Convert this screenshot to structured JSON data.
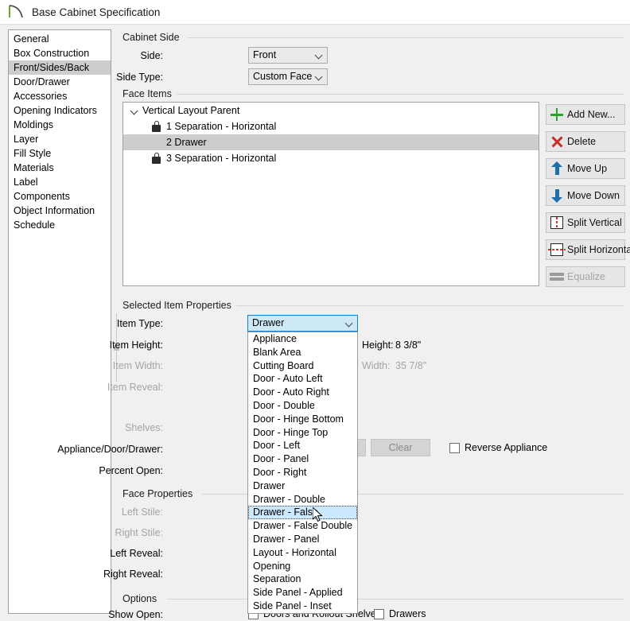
{
  "window": {
    "title": "Base Cabinet Specification",
    "icon": "cabinet-arc-icon"
  },
  "sidebar": {
    "items": [
      {
        "label": "General",
        "selected": false
      },
      {
        "label": "Box Construction",
        "selected": false
      },
      {
        "label": "Front/Sides/Back",
        "selected": true
      },
      {
        "label": "Door/Drawer",
        "selected": false
      },
      {
        "label": "Accessories",
        "selected": false
      },
      {
        "label": "Opening Indicators",
        "selected": false
      },
      {
        "label": "Moldings",
        "selected": false
      },
      {
        "label": "Layer",
        "selected": false
      },
      {
        "label": "Fill Style",
        "selected": false
      },
      {
        "label": "Materials",
        "selected": false
      },
      {
        "label": "Label",
        "selected": false
      },
      {
        "label": "Components",
        "selected": false
      },
      {
        "label": "Object Information",
        "selected": false
      },
      {
        "label": "Schedule",
        "selected": false
      }
    ]
  },
  "cabinet_side": {
    "title": "Cabinet Side",
    "side_label": "Side:",
    "side_value": "Front",
    "side_type_label": "Side Type:",
    "side_type_value": "Custom Face"
  },
  "face_items": {
    "title": "Face Items",
    "tree": [
      {
        "label": "Vertical Layout Parent",
        "indent": 0,
        "caret": true,
        "lock": false,
        "selected": false
      },
      {
        "label": "1 Separation - Horizontal",
        "indent": 1,
        "caret": false,
        "lock": true,
        "selected": false
      },
      {
        "label": "2 Drawer",
        "indent": 1,
        "caret": false,
        "lock": false,
        "selected": true
      },
      {
        "label": "3 Separation - Horizontal",
        "indent": 1,
        "caret": false,
        "lock": true,
        "selected": false
      }
    ],
    "buttons": [
      {
        "label": "Add New...",
        "icon": "plus-icon",
        "enabled": true
      },
      {
        "label": "Delete",
        "icon": "x-icon",
        "enabled": true
      },
      {
        "label": "Move Up",
        "icon": "arrow-up-icon",
        "enabled": true
      },
      {
        "label": "Move Down",
        "icon": "arrow-down-icon",
        "enabled": true
      },
      {
        "label": "Split Vertical",
        "icon": "split-vertical-icon",
        "enabled": true
      },
      {
        "label": "Split Horizontal",
        "icon": "split-horizontal-icon",
        "enabled": true
      },
      {
        "label": "Equalize",
        "icon": "equalize-icon",
        "enabled": false
      }
    ]
  },
  "selected_item_properties": {
    "title": "Selected Item Properties",
    "item_type_label": "Item Type:",
    "item_type_value": "Drawer",
    "item_height_label": "Item Height:",
    "item_width_label": "Item Width:",
    "item_reveal_label": "Item Reveal:",
    "shelves_label": "Shelves:",
    "appliance_door_drawer_label": "Appliance/Door/Drawer:",
    "percent_open_label": "Percent Open:",
    "height_readout_label": "Height:",
    "height_readout_value": "8 3/8\"",
    "width_readout_label": "Width:",
    "width_readout_value": "35 7/8\"",
    "clear_button": "Clear",
    "reverse_appliance_label": "Reverse Appliance"
  },
  "item_type_dropdown": {
    "options": [
      "Appliance",
      "Blank Area",
      "Cutting Board",
      "Door - Auto Left",
      "Door - Auto Right",
      "Door - Double",
      "Door - Hinge Bottom",
      "Door - Hinge Top",
      "Door - Left",
      "Door - Panel",
      "Door - Right",
      "Drawer",
      "Drawer - Double",
      "Drawer - False",
      "Drawer - False Double",
      "Drawer - Panel",
      "Layout - Horizontal",
      "Opening",
      "Separation",
      "Side Panel - Applied",
      "Side Panel - Inset"
    ],
    "highlighted": "Drawer - False"
  },
  "face_properties": {
    "title": "Face Properties",
    "left_stile_label": "Left Stile:",
    "right_stile_label": "Right Stile:",
    "left_reveal_label": "Left Reveal:",
    "right_reveal_label": "Right Reveal:"
  },
  "options": {
    "title": "Options",
    "show_open_label": "Show Open:",
    "doors_rollout_label": "Doors and Rollout Shelves",
    "drawers_label": "Drawers"
  },
  "colors": {
    "accent_blue": "#1a7fc4",
    "highlight": "#cce8ff",
    "selection_gray": "#cdcdcd",
    "green": "#2aa32a",
    "red": "#c23127",
    "arrow_blue": "#1f6fa8",
    "window_bg": "#f0f0f0"
  }
}
